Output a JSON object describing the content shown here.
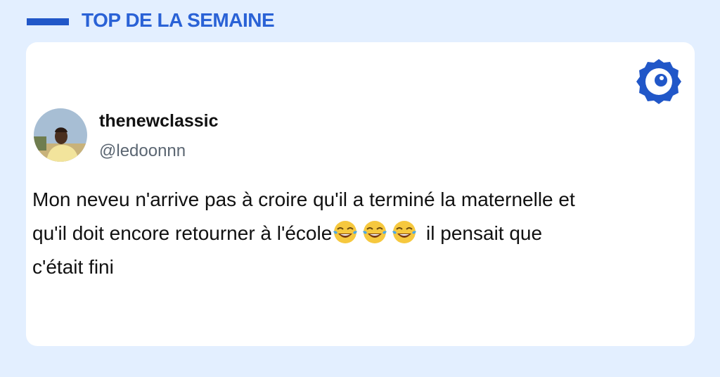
{
  "header": {
    "title": "TOP DE LA SEMAINE"
  },
  "tweet": {
    "display_name": "thenewclassic",
    "handle": "@ledoonnn",
    "text_line_1": "Mon neveu n'arrive pas à croire qu'il a terminé la maternelle et",
    "text_line_2_prefix": "qu'il doit encore retourner à l'école",
    "emoji_icon": "face-with-tears-of-joy-icon",
    "text_line_2_suffix": " il pensait que",
    "text_line_3": "c'était fini"
  },
  "brand": {
    "badge_icon": "brand-logo-badge-icon",
    "accent_color": "#2157c8",
    "background_color": "#e3efff"
  }
}
